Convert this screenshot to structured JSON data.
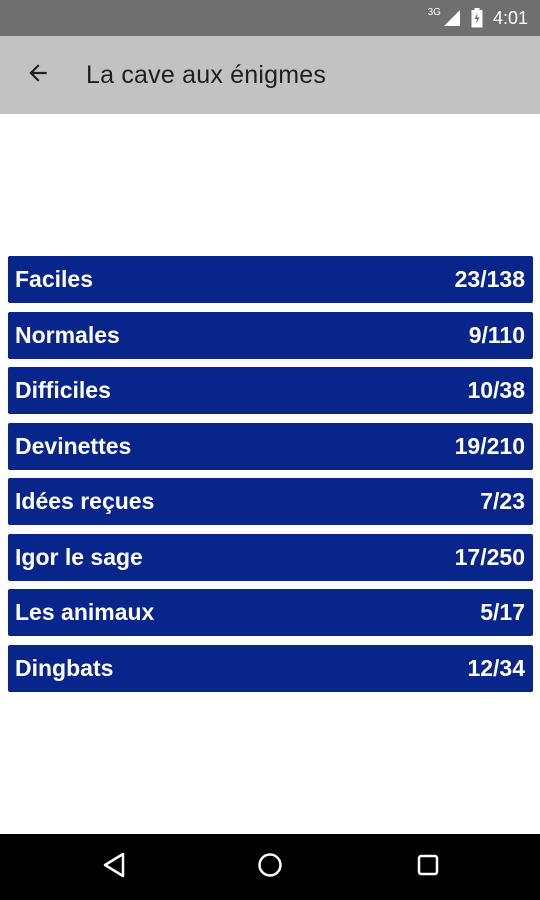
{
  "status_bar": {
    "network": "3G",
    "time": "4:01"
  },
  "toolbar": {
    "back_icon": "arrow-left-icon",
    "title": "La cave aux énigmes"
  },
  "categories": [
    {
      "label": "Faciles",
      "score": "23/138"
    },
    {
      "label": "Normales",
      "score": "9/110"
    },
    {
      "label": "Difficiles",
      "score": "10/38"
    },
    {
      "label": "Devinettes",
      "score": "19/210"
    },
    {
      "label": "Idées reçues",
      "score": "7/23"
    },
    {
      "label": "Igor le sage",
      "score": "17/250"
    },
    {
      "label": "Les animaux",
      "score": "5/17"
    },
    {
      "label": "Dingbats",
      "score": "12/34"
    }
  ],
  "nav_bar": {
    "back_icon": "triangle-back-icon",
    "home_icon": "circle-home-icon",
    "recents_icon": "square-recents-icon"
  },
  "colors": {
    "status_bar": "#6f6f6f",
    "toolbar": "#c2c2c2",
    "row_background": "#08258c",
    "row_text": "#ffffff",
    "nav_bar": "#000000"
  }
}
